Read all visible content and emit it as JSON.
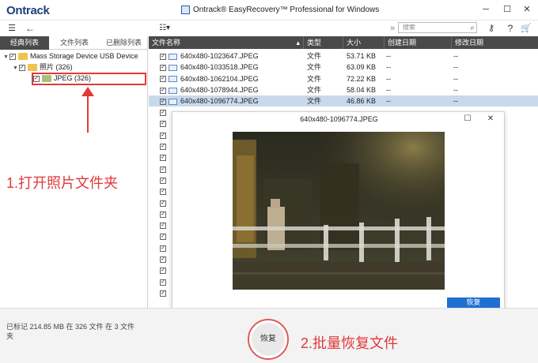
{
  "app": {
    "logo": "Ontrack",
    "title": "Ontrack® EasyRecovery™ Professional for Windows"
  },
  "toolbar": {
    "back_label": "←",
    "view_label": "☷▾",
    "more_label": "»",
    "search_placeholder": "搜索"
  },
  "tabs": [
    {
      "label": "经典列表",
      "active": true
    },
    {
      "label": "文件列表",
      "active": false
    },
    {
      "label": "已删除列表",
      "active": false
    }
  ],
  "tree": [
    {
      "label": "Mass Storage Device USB Device"
    },
    {
      "label": "照片 (326)"
    },
    {
      "label": "JPEG (326)"
    }
  ],
  "columns": [
    "文件名称",
    "类型",
    "大小",
    "创建日期",
    "修改日期"
  ],
  "files": [
    {
      "name": "640x480-1023647.JPEG",
      "type": "文件",
      "size": "53.71 KB",
      "created": "--",
      "modified": "--"
    },
    {
      "name": "640x480-1033518.JPEG",
      "type": "文件",
      "size": "63.09 KB",
      "created": "--",
      "modified": "--"
    },
    {
      "name": "640x480-1062104.JPEG",
      "type": "文件",
      "size": "72.22 KB",
      "created": "--",
      "modified": "--"
    },
    {
      "name": "640x480-1078944.JPEG",
      "type": "文件",
      "size": "58.04 KB",
      "created": "--",
      "modified": "--"
    },
    {
      "name": "640x480-1096774.JPEG",
      "type": "文件",
      "size": "46.86 KB",
      "created": "--",
      "modified": "--",
      "selected": true
    }
  ],
  "preview": {
    "title": "640x480-1096774.JPEG",
    "restore_label": "恢复"
  },
  "status": {
    "text": "已标记 214.85 MB 在 326 文件 在 3 文件夹"
  },
  "bottom": {
    "restore_label": "恢复"
  },
  "annotations": {
    "step1": "1.打开照片文件夹",
    "step2": "2.批量恢复文件"
  },
  "colors": {
    "accent": "#1f6fd1",
    "annotation": "#e0393a",
    "header": "#4a4a4a"
  }
}
